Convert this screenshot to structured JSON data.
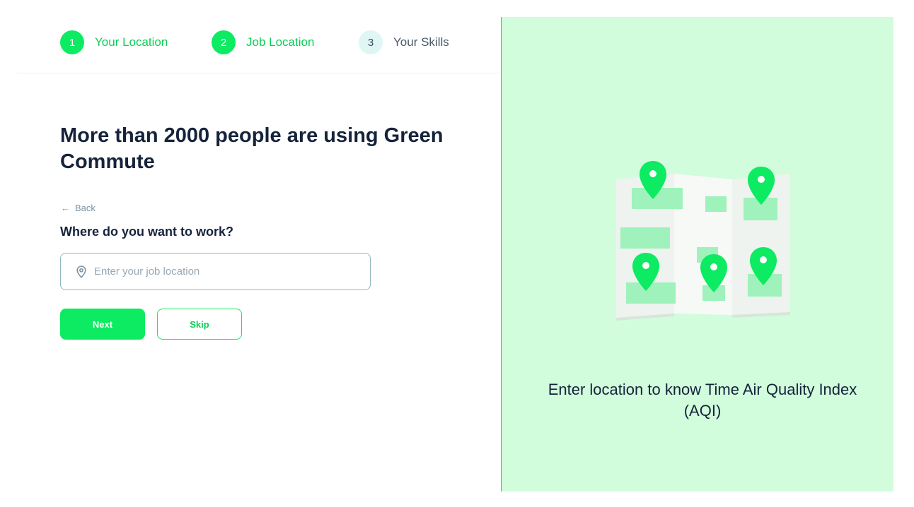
{
  "stepper": {
    "steps": [
      {
        "number": "1",
        "label": "Your Location",
        "state": "completed"
      },
      {
        "number": "2",
        "label": "Job Location",
        "state": "active"
      },
      {
        "number": "3",
        "label": "Your Skills",
        "state": "upcoming"
      }
    ]
  },
  "main": {
    "headline": "More than 2000 people are using Green Commute",
    "back_label": "Back",
    "question": "Where do you want to work?",
    "location_input": {
      "value": "",
      "placeholder": "Enter your job location",
      "icon": "location-pin-icon"
    },
    "next_label": "Next",
    "skip_label": "Skip"
  },
  "illustration": {
    "name": "folded-map-with-pins",
    "caption": "Enter location to know Time Air Quality Index (AQI)"
  },
  "colors": {
    "accent": "#0ceb61",
    "accent_text": "#0bcf56",
    "panel_bg": "#d1fddc",
    "heading": "#15233b",
    "inactive_step_bg": "#dff6f5"
  }
}
